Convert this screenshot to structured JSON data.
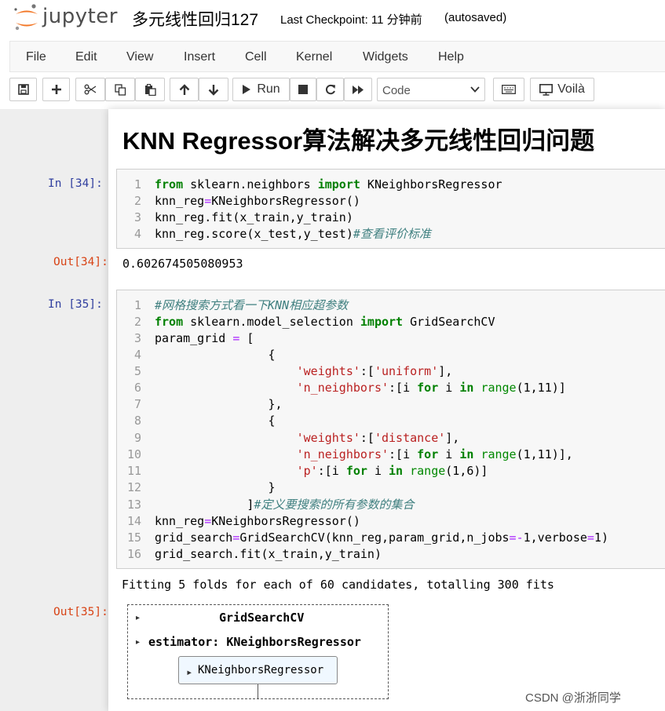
{
  "header": {
    "logo_text": "jupyter",
    "notebook_title": "多元线性回归127",
    "checkpoint": "Last Checkpoint: 11 分钟前",
    "autosaved": "(autosaved)"
  },
  "menu": [
    "File",
    "Edit",
    "View",
    "Insert",
    "Cell",
    "Kernel",
    "Widgets",
    "Help"
  ],
  "toolbar": {
    "run_label": "Run",
    "cell_type": "Code",
    "voila_label": "Voilà"
  },
  "heading": "KNN Regressor算法解决多元线性回归问题",
  "cells": [
    {
      "in_prompt": "In  [34]:",
      "line_numbers": [
        "1",
        "2",
        "3",
        "4"
      ],
      "code": [
        "from sklearn.neighbors import KNeighborsRegressor",
        "knn_reg=KNeighborsRegressor()",
        "knn_reg.fit(x_train,y_train)",
        "knn_reg.score(x_test,y_test)#查看评价标准"
      ],
      "out_prompt": "Out[34]:",
      "output": "0.602674505080953"
    },
    {
      "in_prompt": "In  [35]:",
      "line_numbers": [
        "1",
        "2",
        "3",
        "4",
        "5",
        "6",
        "7",
        "8",
        "9",
        "10",
        "11",
        "12",
        "13",
        "14",
        "15",
        "16"
      ],
      "code": [
        "#网格搜索方式看一下KNN相应超参数",
        "from sklearn.model_selection import GridSearchCV",
        "param_grid = [",
        "                {",
        "                    'weights':['uniform'],",
        "                    'n_neighbors':[i for i in range(1,11)]",
        "                },",
        "                {",
        "                    'weights':['distance'],",
        "                    'n_neighbors':[i for i in range(1,11)],",
        "                    'p':[i for i in range(1,6)]",
        "                }",
        "             ]#定义要搜索的所有参数的集合",
        "knn_reg=KNeighborsRegressor()",
        "grid_search=GridSearchCV(knn_reg,param_grid,n_jobs=-1,verbose=1)",
        "grid_search.fit(x_train,y_train)"
      ],
      "stdout": "Fitting 5 folds for each of 60 candidates, totalling 300 fits",
      "out_prompt": "Out[35]:",
      "estimator": {
        "outer": "GridSearchCV",
        "param": "estimator: KNeighborsRegressor",
        "inner": "KNeighborsRegressor"
      }
    }
  ],
  "watermark": "CSDN @浙浙同学"
}
